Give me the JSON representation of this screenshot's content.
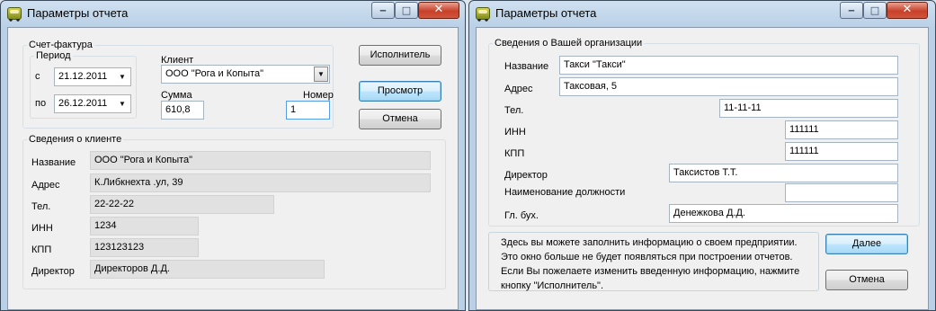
{
  "left_window": {
    "title": "Параметры отчета",
    "titlebar_buttons": {
      "minimize": "‒",
      "maximize": "□",
      "close": "✕"
    },
    "invoice_group": {
      "title": "Счет-фактура",
      "period": {
        "title": "Период",
        "from_label": "с",
        "from_value": "21.12.2011",
        "to_label": "по",
        "to_value": "26.12.2011"
      },
      "client": {
        "label": "Клиент",
        "value": "ООО \"Рога и Копыта\""
      },
      "sum": {
        "label": "Сумма",
        "value": "610,8"
      },
      "number": {
        "label": "Номер",
        "value": "1"
      }
    },
    "buttons": {
      "executor": "Исполнитель",
      "preview": "Просмотр",
      "cancel": "Отмена"
    },
    "client_info": {
      "title": "Сведения о клиенте",
      "name": {
        "label": "Название",
        "value": "ООО \"Рога и Копыта\""
      },
      "address": {
        "label": "Адрес",
        "value": "К.Либкнехта .ул, 39"
      },
      "phone": {
        "label": "Тел.",
        "value": "22-22-22"
      },
      "inn": {
        "label": "ИНН",
        "value": "1234"
      },
      "kpp": {
        "label": "КПП",
        "value": "123123123"
      },
      "director": {
        "label": "Директор",
        "value": "Директоров Д.Д."
      }
    }
  },
  "right_window": {
    "title": "Параметры отчета",
    "titlebar_buttons": {
      "minimize": "‒",
      "maximize": "□",
      "close": "✕"
    },
    "org_info": {
      "title": "Сведения о Вашей организации",
      "name": {
        "label": "Название",
        "value": "Такси \"Такси\""
      },
      "address": {
        "label": "Адрес",
        "value": "Таксовая, 5"
      },
      "phone": {
        "label": "Тел.",
        "value": "11-11-11"
      },
      "inn": {
        "label": "ИНН",
        "value": "111111"
      },
      "kpp": {
        "label": "КПП",
        "value": "111111"
      },
      "director": {
        "label": "Директор",
        "value": "Таксистов Т.Т."
      },
      "position": {
        "label": "Наименование должности",
        "value": ""
      },
      "accountant": {
        "label": "Гл. бух.",
        "value": "Денежкова Д.Д."
      }
    },
    "info_lines": [
      "Здесь вы можете заполнить информацию о своем предприятии.",
      "Это окно больше не будет появляться при построении отчетов.",
      "Если Вы пожелаете изменить введенную информацию, нажмите",
      "кнопку \"Исполнитель\"."
    ],
    "buttons": {
      "next": "Далее",
      "cancel": "Отмена"
    }
  }
}
